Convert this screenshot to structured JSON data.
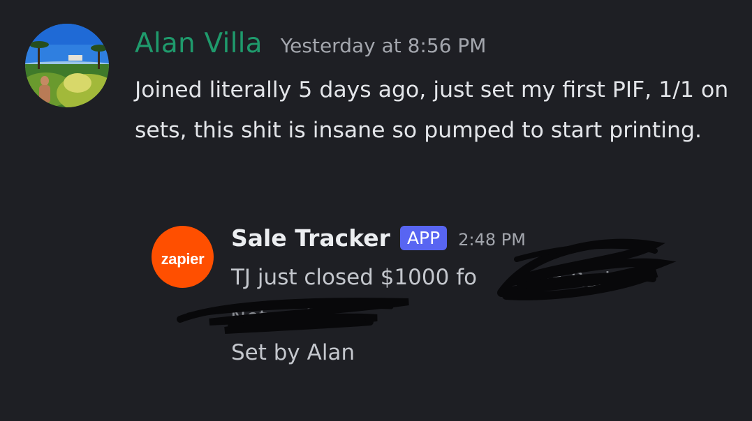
{
  "message1": {
    "username": "Alan Villa",
    "timestamp": "Yesterday at 8:56 PM",
    "text": "Joined literally 5 days ago, just set my first PIF, 1/1 on sets, this shit is insane so pumped to start printing.",
    "avatar": "profile-photo"
  },
  "message2": {
    "bot_name": "Sale Tracker",
    "badge": "APP",
    "time": "2:48 PM",
    "avatar_logo": "zapier",
    "line1": "TJ just closed $1000 fo",
    "line3": "Set by Alan"
  },
  "colors": {
    "background": "#1e1f24",
    "username": "#1f9a6c",
    "badge": "#5865f2",
    "zapier": "#ff4f00"
  }
}
